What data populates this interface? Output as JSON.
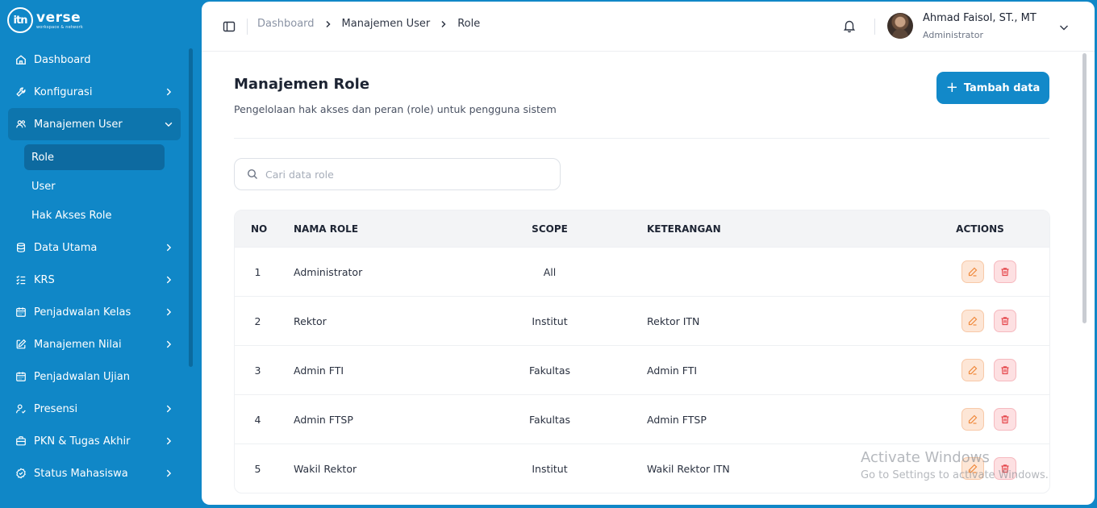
{
  "logo": {
    "mark": "itn",
    "text": "verse",
    "tagline": "workspace & network"
  },
  "sidebar": {
    "items": [
      {
        "label": "Dashboard",
        "icon": "home-icon",
        "has_children": false
      },
      {
        "label": "Konfigurasi",
        "icon": "wrench-icon",
        "has_children": true
      },
      {
        "label": "Manajemen User",
        "icon": "users-icon",
        "has_children": true,
        "open": true
      },
      {
        "label": "Data Utama",
        "icon": "database-icon",
        "has_children": true
      },
      {
        "label": "KRS",
        "icon": "list-check-icon",
        "has_children": true
      },
      {
        "label": "Penjadwalan Kelas",
        "icon": "calendar-icon",
        "has_children": true
      },
      {
        "label": "Manajemen Nilai",
        "icon": "edit-icon",
        "has_children": true
      },
      {
        "label": "Penjadwalan Ujian",
        "icon": "calendar-icon",
        "has_children": false
      },
      {
        "label": "Presensi",
        "icon": "user-check-icon",
        "has_children": true
      },
      {
        "label": "PKN & Tugas Akhir",
        "icon": "briefcase-icon",
        "has_children": true
      },
      {
        "label": "Status Mahasiswa",
        "icon": "badge-icon",
        "has_children": true
      }
    ],
    "submenu": [
      {
        "label": "Role",
        "active": true
      },
      {
        "label": "User",
        "active": false
      },
      {
        "label": "Hak Akses Role",
        "active": false
      }
    ]
  },
  "breadcrumb": [
    "Dashboard",
    "Manajemen User",
    "Role"
  ],
  "user": {
    "name": "Ahmad Faisol, ST., MT",
    "role": "Administrator"
  },
  "page": {
    "title": "Manajemen Role",
    "subtitle": "Pengelolaan hak akses dan peran (role) untuk pengguna sistem",
    "add_label": "Tambah data"
  },
  "search": {
    "placeholder": "Cari data role",
    "value": ""
  },
  "table": {
    "headers": {
      "no": "NO",
      "name": "NAMA ROLE",
      "scope": "SCOPE",
      "ket": "KETERANGAN",
      "actions": "ACTIONS"
    },
    "rows": [
      {
        "no": "1",
        "name": "Administrator",
        "scope": "All",
        "ket": ""
      },
      {
        "no": "2",
        "name": "Rektor",
        "scope": "Institut",
        "ket": "Rektor ITN"
      },
      {
        "no": "3",
        "name": "Admin FTI",
        "scope": "Fakultas",
        "ket": "Admin FTI"
      },
      {
        "no": "4",
        "name": "Admin FTSP",
        "scope": "Fakultas",
        "ket": "Admin FTSP"
      },
      {
        "no": "5",
        "name": "Wakil Rektor",
        "scope": "Institut",
        "ket": "Wakil Rektor ITN"
      }
    ]
  },
  "watermark": {
    "line1": "Activate Windows",
    "line2": "Go to Settings to activate Windows."
  },
  "colors": {
    "primary": "#1087c7",
    "active_sub": "#0d6aa0",
    "edit": "#f08a3c",
    "delete": "#e5484d"
  }
}
